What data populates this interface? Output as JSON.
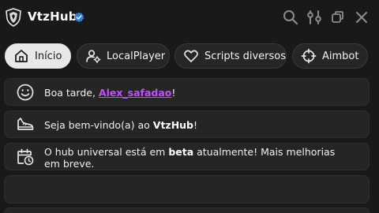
{
  "app": {
    "title": "VtzHub"
  },
  "icons": {
    "logo": "shield-crest-icon",
    "verified": "verified-badge-icon",
    "search": "search-icon",
    "settings": "sliders-icon",
    "minimize": "copy-windows-icon",
    "close": "close-icon"
  },
  "colors": {
    "background": "#191919",
    "card": "#252525",
    "active_tab": "#e8e8e8",
    "verified": "#2f7fe0",
    "username": "#c24fff"
  },
  "tabs": [
    {
      "label": "Início",
      "icon": "home-icon",
      "active": true
    },
    {
      "label": "LocalPlayer",
      "icon": "user-settings-icon",
      "active": false
    },
    {
      "label": "Scripts diversos",
      "icon": "heart-icon",
      "active": false
    },
    {
      "label": "Aimbot",
      "icon": "crosshair-icon",
      "active": false
    }
  ],
  "cards": {
    "greeting": {
      "prefix": "Boa tarde, ",
      "username": "Alex_safadao",
      "suffix": "!"
    },
    "welcome": {
      "prefix": "Seja bem-vindo(a) ao ",
      "hub": "VtzHub",
      "suffix": "!"
    },
    "beta": {
      "prefix": "O hub universal está em ",
      "highlight": "beta",
      "suffix_line1": " atualmente! Mais melhorias",
      "line2": "em breve."
    }
  }
}
